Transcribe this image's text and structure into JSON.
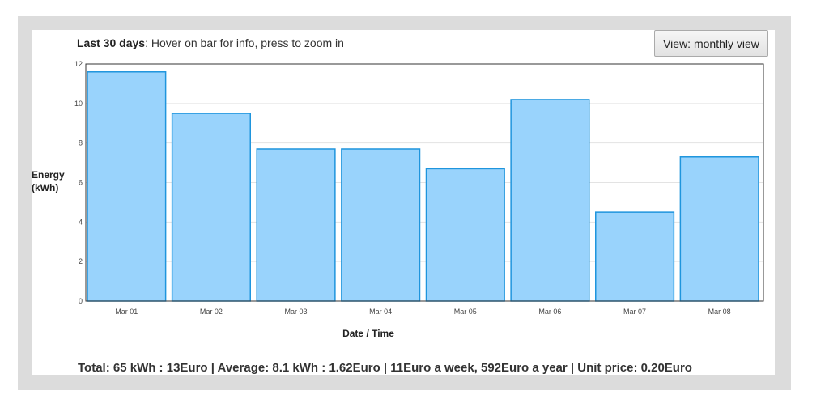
{
  "header": {
    "title_bold": "Last 30 days",
    "title_rest": ": Hover on bar for info, press to zoom in",
    "view_button": "View: monthly view"
  },
  "footer_text": "Total: 65 kWh : 13Euro | Average: 8.1 kWh : 1.62Euro | 11Euro a week, 592Euro a year | Unit price: 0.20Euro",
  "colors": {
    "bar_fill": "#99d3fc",
    "bar_stroke": "#1f95dd",
    "grid": "#e3e3e3",
    "axis": "#333333"
  },
  "chart_data": {
    "type": "bar",
    "categories": [
      "Mar 01",
      "Mar 02",
      "Mar 03",
      "Mar 04",
      "Mar 05",
      "Mar 06",
      "Mar 07",
      "Mar 08"
    ],
    "values": [
      11.6,
      9.5,
      7.7,
      7.7,
      6.7,
      10.2,
      4.5,
      7.3
    ],
    "ylim": [
      0,
      12
    ],
    "yticks": [
      0,
      2,
      4,
      6,
      8,
      10,
      12
    ],
    "ylabel": "Energy (kWh)",
    "xlabel": "Date / Time",
    "grid": true
  }
}
